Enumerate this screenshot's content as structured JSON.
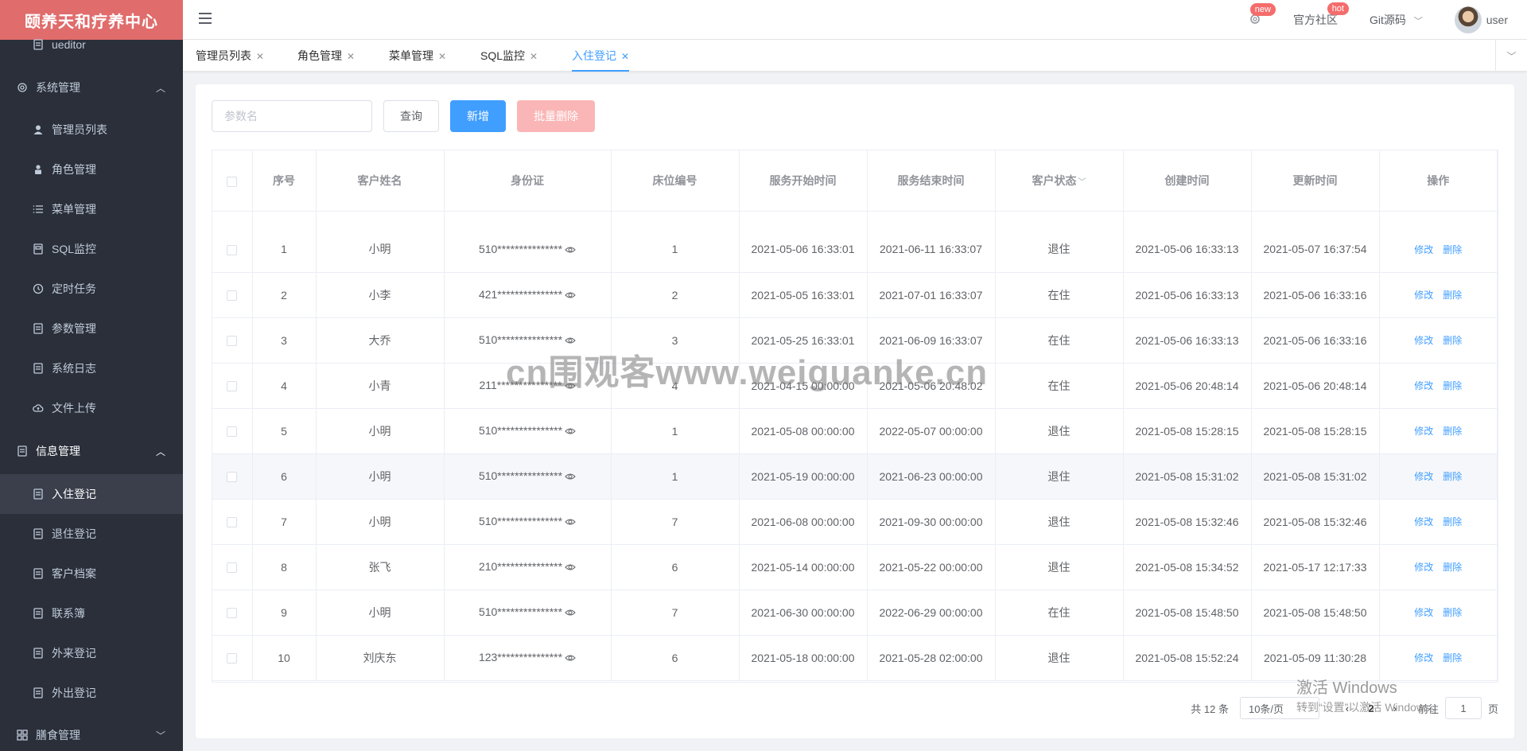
{
  "app": {
    "title": "颐养天和疗养中心"
  },
  "sidebar": {
    "items": [
      {
        "label": "ueditor",
        "icon": "doc-icon",
        "kind": "item"
      },
      {
        "label": "系统管理",
        "icon": "gear-icon",
        "kind": "group",
        "arrow": "︿"
      },
      {
        "label": "管理员列表",
        "icon": "user-icon",
        "kind": "item"
      },
      {
        "label": "角色管理",
        "icon": "person-icon",
        "kind": "item"
      },
      {
        "label": "菜单管理",
        "icon": "list-icon",
        "kind": "item"
      },
      {
        "label": "SQL监控",
        "icon": "monitor-icon",
        "kind": "item"
      },
      {
        "label": "定时任务",
        "icon": "clock-icon",
        "kind": "item"
      },
      {
        "label": "参数管理",
        "icon": "doc-icon",
        "kind": "item"
      },
      {
        "label": "系统日志",
        "icon": "doc-icon",
        "kind": "item"
      },
      {
        "label": "文件上传",
        "icon": "cloud-icon",
        "kind": "item"
      },
      {
        "label": "信息管理",
        "icon": "doc-icon",
        "kind": "group",
        "arrow": "︿"
      },
      {
        "label": "入住登记",
        "icon": "doc-icon",
        "kind": "item",
        "active": true
      },
      {
        "label": "退住登记",
        "icon": "doc-icon",
        "kind": "item"
      },
      {
        "label": "客户档案",
        "icon": "doc-icon",
        "kind": "item"
      },
      {
        "label": "联系簿",
        "icon": "doc-icon",
        "kind": "item"
      },
      {
        "label": "外来登记",
        "icon": "doc-icon",
        "kind": "item"
      },
      {
        "label": "外出登记",
        "icon": "doc-icon",
        "kind": "item"
      },
      {
        "label": "膳食管理",
        "icon": "grid-icon",
        "kind": "group",
        "arrow": "﹀"
      }
    ]
  },
  "header": {
    "badge_new": "new",
    "community": "官方社区",
    "badge_hot": "hot",
    "git": "Git源码",
    "user": "user"
  },
  "tabs": [
    {
      "label": "管理员列表"
    },
    {
      "label": "角色管理"
    },
    {
      "label": "菜单管理"
    },
    {
      "label": "SQL监控"
    },
    {
      "label": "入住登记",
      "active": true
    }
  ],
  "toolbar": {
    "search_placeholder": "参数名",
    "query": "查询",
    "add": "新增",
    "batch_delete": "批量删除"
  },
  "table": {
    "columns": [
      "序号",
      "客户姓名",
      "身份证",
      "床位编号",
      "服务开始时间",
      "服务结束时间",
      "客户状态",
      "创建时间",
      "更新时间",
      "操作"
    ],
    "edit_label": "修改",
    "delete_label": "删除",
    "rows": [
      {
        "no": "1",
        "name": "小明",
        "id": "510***************",
        "bed": "1",
        "start": "2021-05-06 16:33:01",
        "end": "2021-06-11 16:33:07",
        "status": "退住",
        "created": "2021-05-06 16:33:13",
        "updated": "2021-05-07 16:37:54"
      },
      {
        "no": "2",
        "name": "小李",
        "id": "421***************",
        "bed": "2",
        "start": "2021-05-05 16:33:01",
        "end": "2021-07-01 16:33:07",
        "status": "在住",
        "created": "2021-05-06 16:33:13",
        "updated": "2021-05-06 16:33:16"
      },
      {
        "no": "3",
        "name": "大乔",
        "id": "510***************",
        "bed": "3",
        "start": "2021-05-25 16:33:01",
        "end": "2021-06-09 16:33:07",
        "status": "在住",
        "created": "2021-05-06 16:33:13",
        "updated": "2021-05-06 16:33:16"
      },
      {
        "no": "4",
        "name": "小青",
        "id": "211***************",
        "bed": "4",
        "start": "2021-04-15 00:00:00",
        "end": "2021-05-06 20:48:02",
        "status": "在住",
        "created": "2021-05-06 20:48:14",
        "updated": "2021-05-06 20:48:14"
      },
      {
        "no": "5",
        "name": "小明",
        "id": "510***************",
        "bed": "1",
        "start": "2021-05-08 00:00:00",
        "end": "2022-05-07 00:00:00",
        "status": "退住",
        "created": "2021-05-08 15:28:15",
        "updated": "2021-05-08 15:28:15"
      },
      {
        "no": "6",
        "name": "小明",
        "id": "510***************",
        "bed": "1",
        "start": "2021-05-19 00:00:00",
        "end": "2021-06-23 00:00:00",
        "status": "退住",
        "created": "2021-05-08 15:31:02",
        "updated": "2021-05-08 15:31:02",
        "hover": true
      },
      {
        "no": "7",
        "name": "小明",
        "id": "510***************",
        "bed": "7",
        "start": "2021-06-08 00:00:00",
        "end": "2021-09-30 00:00:00",
        "status": "退住",
        "created": "2021-05-08 15:32:46",
        "updated": "2021-05-08 15:32:46"
      },
      {
        "no": "8",
        "name": "张飞",
        "id": "210***************",
        "bed": "6",
        "start": "2021-05-14 00:00:00",
        "end": "2021-05-22 00:00:00",
        "status": "退住",
        "created": "2021-05-08 15:34:52",
        "updated": "2021-05-17 12:17:33"
      },
      {
        "no": "9",
        "name": "小明",
        "id": "510***************",
        "bed": "7",
        "start": "2021-06-30 00:00:00",
        "end": "2022-06-29 00:00:00",
        "status": "在住",
        "created": "2021-05-08 15:48:50",
        "updated": "2021-05-08 15:48:50"
      },
      {
        "no": "10",
        "name": "刘庆东",
        "id": "123***************",
        "bed": "6",
        "start": "2021-05-18 00:00:00",
        "end": "2021-05-28 02:00:00",
        "status": "退住",
        "created": "2021-05-08 15:52:24",
        "updated": "2021-05-09 11:30:28"
      }
    ]
  },
  "pager": {
    "total": "共 12 条",
    "page_size": "10条/页",
    "prev": "‹",
    "current": "2",
    "next": "›",
    "goto": "前往",
    "goto_value": "1",
    "page_unit": "页"
  },
  "overlay": {
    "watermark": "cn围观客www.weiguanke.cn",
    "activate_title": "激活 Windows",
    "activate_sub": "转到“设置”以激活 Windows。"
  },
  "colors": {
    "primary": "#409eff",
    "danger_light": "#fab6b6",
    "logo_bg": "#e06c6c",
    "sidebar_bg": "#2b2f3a",
    "badge": "#f56c6c"
  }
}
